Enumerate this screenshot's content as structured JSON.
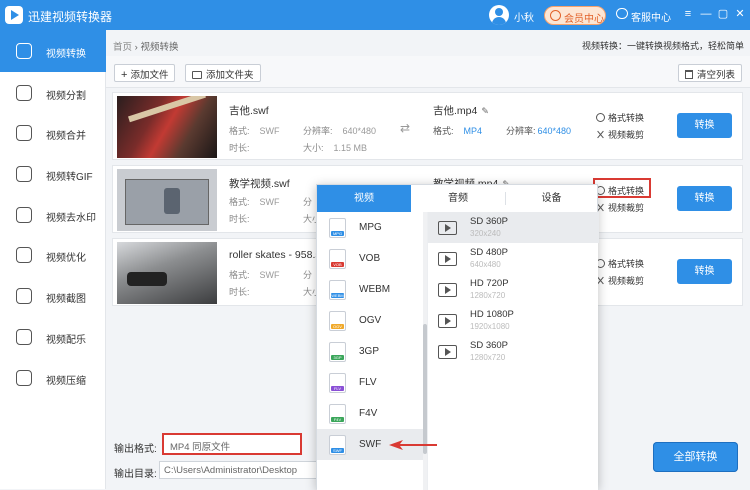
{
  "app": {
    "title": "迅建视频转换器",
    "username": "小秋",
    "vip_label": "会员中心",
    "service_label": "客服中心"
  },
  "window_controls": [
    "minimize-icon",
    "restore-icon",
    "close-icon"
  ],
  "sidebar": {
    "items": [
      {
        "label": "视频转换",
        "icon": "video-convert-icon",
        "active": true
      },
      {
        "label": "视频分割",
        "icon": "split-icon"
      },
      {
        "label": "视频合并",
        "icon": "merge-icon"
      },
      {
        "label": "视频转GIF",
        "icon": "gif-icon"
      },
      {
        "label": "视频去水印",
        "icon": "watermark-icon"
      },
      {
        "label": "视频优化",
        "icon": "optimize-icon"
      },
      {
        "label": "视频截图",
        "icon": "screenshot-icon"
      },
      {
        "label": "视频配乐",
        "icon": "music-icon"
      },
      {
        "label": "视频压缩",
        "icon": "compress-icon"
      }
    ]
  },
  "breadcrumb": {
    "home": "首页",
    "sep": "›",
    "current": "视频转换"
  },
  "tagline": "视频转换：一键转换视频格式，轻松简单",
  "toolbar": {
    "add_file": "添加文件",
    "add_folder": "添加文件夹",
    "clear_list": "清空列表"
  },
  "labels": {
    "format": "格式:",
    "duration": "时长:",
    "resolution": "分辨率:",
    "size": "大小:",
    "format_convert": "格式转换",
    "video_crop": "视频裁剪",
    "convert": "转换"
  },
  "files": [
    {
      "name": "吉他.swf",
      "format": "SWF",
      "resolution": "640*480",
      "duration": "",
      "size": "1.15 MB",
      "out_name": "吉他.mp4",
      "out_format": "MP4",
      "out_resolution": "640*480",
      "size_visible": "大小:",
      "res_visible": "分辨率:"
    },
    {
      "name": "教学视频.swf",
      "format": "SWF",
      "size_prefix": "大小",
      "res_prefix": "分",
      "out_name": "教学视频.mp4"
    },
    {
      "name": "roller skates - 958.s",
      "format": "SWF",
      "size_prefix": "大小",
      "res_prefix": "分"
    }
  ],
  "popup": {
    "tabs": [
      "视频",
      "音频",
      "设备"
    ],
    "formats": [
      {
        "name": "MPG",
        "color": "#2f8fe6"
      },
      {
        "name": "VOB",
        "color": "#d93a33"
      },
      {
        "name": "WEBM",
        "color": "#2f8fe6"
      },
      {
        "name": "OGV",
        "color": "#f0a92a"
      },
      {
        "name": "3GP",
        "color": "#3aa65a"
      },
      {
        "name": "FLV",
        "color": "#8a4fd6"
      },
      {
        "name": "F4V",
        "color": "#3aa65a"
      },
      {
        "name": "SWF",
        "color": "#2f8fe6",
        "selected": true
      }
    ],
    "qualities": [
      {
        "title": "SD 360P",
        "res": "320x240",
        "selected": true
      },
      {
        "title": "SD 480P",
        "res": "640x480"
      },
      {
        "title": "HD 720P",
        "res": "1280x720"
      },
      {
        "title": "HD 1080P",
        "res": "1920x1080"
      },
      {
        "title": "SD 360P",
        "res": "1280x720"
      }
    ]
  },
  "bottom": {
    "output_format_label": "输出格式:",
    "output_format_value": "MP4    同原文件",
    "output_dir_label": "输出目录:",
    "output_dir_value": "C:\\Users\\Administrator\\Desktop",
    "convert_all": "全部转换"
  },
  "colors": {
    "accent": "#2f8fe6",
    "highlight": "#d93a33"
  }
}
